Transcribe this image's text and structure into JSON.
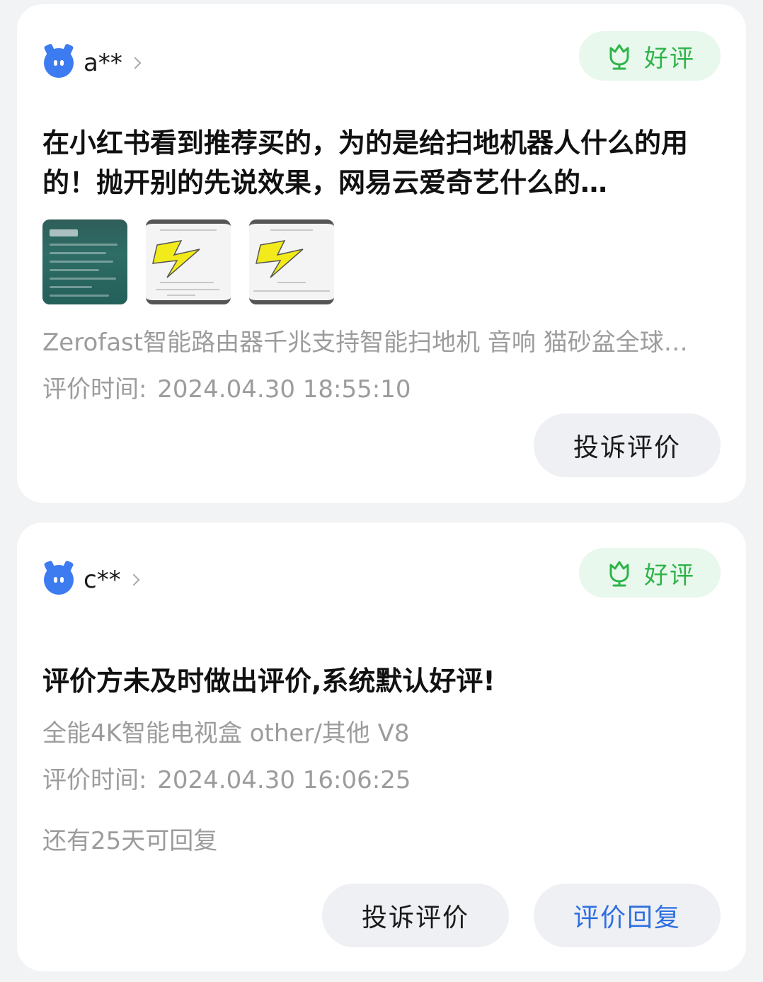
{
  "reviews": [
    {
      "user": "a**",
      "rating_label": "好评",
      "text": "在小红书看到推荐买的，为的是给扫地机器人什么的用的！抛开别的先说效果，网易云爱奇艺什么的…",
      "product": "Zerofast智能路由器千兆支持智能扫地机 音响 猫砂盆全球…",
      "time_label": "评价时间:",
      "time_value": "2024.04.30 18:55:10",
      "buttons": {
        "complain": "投诉评价"
      }
    },
    {
      "user": "c**",
      "rating_label": "好评",
      "text": "评价方未及时做出评价,系统默认好评!",
      "product": "全能4K智能电视盒 other/其他 V8",
      "time_label": "评价时间:",
      "time_value": "2024.04.30 16:06:25",
      "remaining": "还有25天可回复",
      "buttons": {
        "complain": "投诉评价",
        "reply": "评价回复"
      }
    }
  ],
  "icons": {
    "avatar": "blue-cat-avatar-icon",
    "chevron": "chevron-right-icon",
    "badge": "tulip-icon"
  },
  "colors": {
    "badge_bg": "#e9f8ec",
    "badge_text": "#2eb44a",
    "link_blue": "#2f6fe0",
    "avatar_blue": "#3d7bf0"
  }
}
